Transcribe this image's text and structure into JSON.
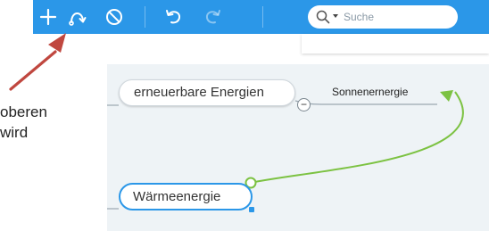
{
  "toolbar": {
    "bg_color": "#2b97e8",
    "buttons": [
      {
        "icon": "plus-icon"
      },
      {
        "icon": "relationship-icon"
      },
      {
        "icon": "prohibit-icon"
      },
      {
        "icon": "undo-icon"
      },
      {
        "icon": "redo-icon",
        "disabled": true
      }
    ],
    "search": {
      "placeholder": "Suche",
      "value": ""
    }
  },
  "side_text": {
    "line1": "oberen",
    "line2": "wird"
  },
  "map": {
    "topic_1": "erneuerbare Energien",
    "subtopic": "Sonnenernergie",
    "topic_2": "Wärmeenergie",
    "collapse_symbol": "−",
    "relation_color": "#7cc242",
    "selection_color": "#2b97e8"
  },
  "annotation": {
    "arrow_color": "#c0473f"
  }
}
